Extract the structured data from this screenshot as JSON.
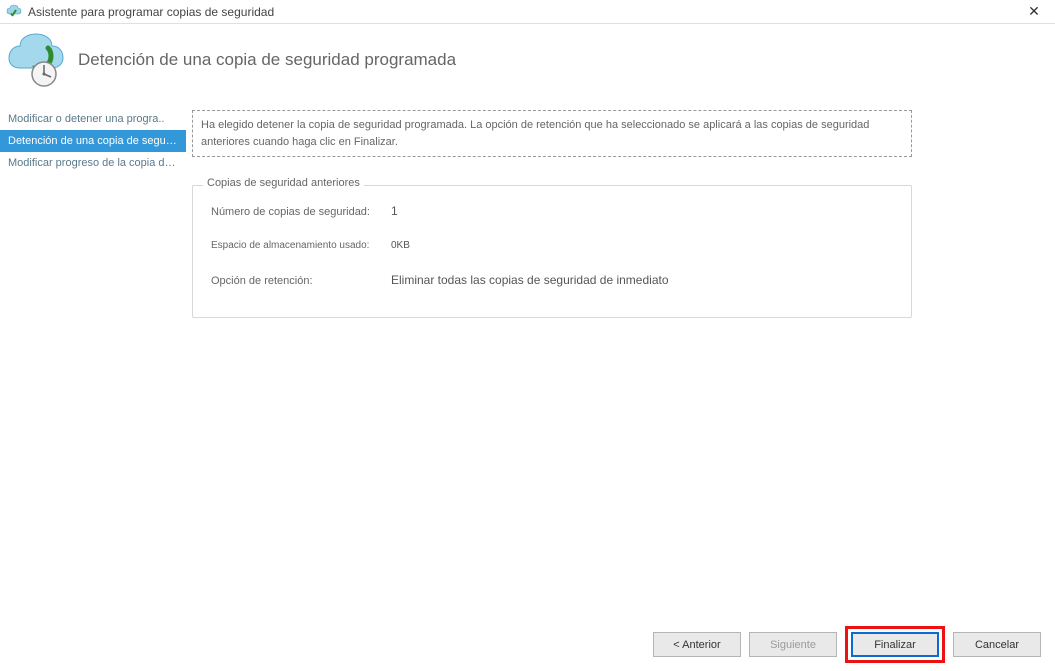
{
  "window": {
    "title": "Asistente para programar copias de seguridad"
  },
  "header": {
    "title": "Detención de una copia de seguridad programada"
  },
  "sidebar": {
    "items": [
      {
        "label": "Modificar o detener una progra.."
      },
      {
        "label": "Detención de una copia de seguridad programada"
      },
      {
        "label": "Modificar progreso de la copia de seguridad"
      }
    ],
    "selected_index": 1
  },
  "content": {
    "info_text": "Ha elegido detener la copia de seguridad programada. La opción de retención que ha seleccionado se aplicará a las copias de seguridad anteriores cuando haga clic en Finalizar.",
    "fieldset_legend": "Copias de seguridad anteriores",
    "rows": [
      {
        "label": "Número de copias de seguridad:",
        "value": "1"
      },
      {
        "label": "Espacio de almacenamiento usado:",
        "value": "0KB"
      },
      {
        "label": "Opción de retención:",
        "value": "Eliminar todas las copias de seguridad de inmediato"
      }
    ]
  },
  "footer": {
    "previous": "<  Anterior",
    "next": "Siguiente",
    "finish": "Finalizar",
    "cancel": "Cancelar"
  }
}
